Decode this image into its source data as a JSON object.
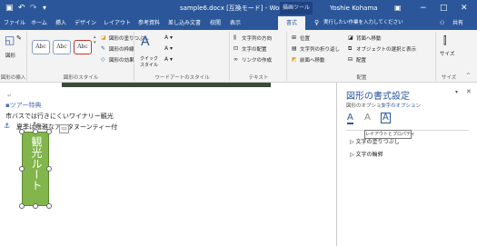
{
  "titlebar": {
    "save_icon": "save-icon",
    "undo_icon": "undo-icon",
    "redo_icon": "redo-icon",
    "customize_icon": "customize-icon",
    "doc_title": "sample6.docx [互換モード] - Word",
    "context_label": "描画ツール",
    "user": "Yoshie Kohama",
    "options_icon": "ribbon-display-icon",
    "minimize": "−",
    "maximize": "□",
    "close": "✕",
    "colors": {
      "title_bar": "#2b579a"
    }
  },
  "tabs": [
    "ファイル",
    "ホーム",
    "挿入",
    "デザイン",
    "レイアウト",
    "参考資料",
    "差し込み文書",
    "校閲",
    "表示",
    "書式"
  ],
  "active_tab": "書式",
  "tellme": "実行したい作業を入力してください",
  "share": "共有",
  "ribbon": {
    "insert_shapes": {
      "label": "図形の挿入",
      "btn": "図形"
    },
    "shape_styles": {
      "label": "図形のスタイル",
      "style_samples": [
        "Abc",
        "Abc",
        "Abc"
      ],
      "fill": "図形の塗りつぶし",
      "outline": "図形の枠線",
      "effects": "図形の効果"
    },
    "wordart": {
      "label": "ワードアートのスタイル",
      "quick": "クイック",
      "style": "スタイル"
    },
    "text": {
      "label": "テキスト",
      "direction": "文字列の方向",
      "align": "文字の配置",
      "link": "リンクの作成"
    },
    "arrange": {
      "label": "配置",
      "position": "位置",
      "wrap": "文字列の折り返し",
      "forward": "前面へ移動",
      "backward": "背面へ移動",
      "selection": "オブジェクトの選択と表示",
      "align": "配置"
    },
    "size": {
      "label": "サイズ",
      "btn": "サイズ"
    }
  },
  "document": {
    "line1": "ツアー特典",
    "line2": "市バスでは行きにくいワイナリー観光",
    "line3": "夏季は嗜雅なアフタヌーンティー付",
    "shape_text": "観光ルート"
  },
  "pane": {
    "title": "図形の書式設定",
    "tab_shape": "図形のオプション",
    "tab_text": "文字のオプション",
    "tooltip": "レイアウトとプロパティ",
    "section1": "文字の塗りつぶし",
    "section2": "文字の輪郭"
  }
}
